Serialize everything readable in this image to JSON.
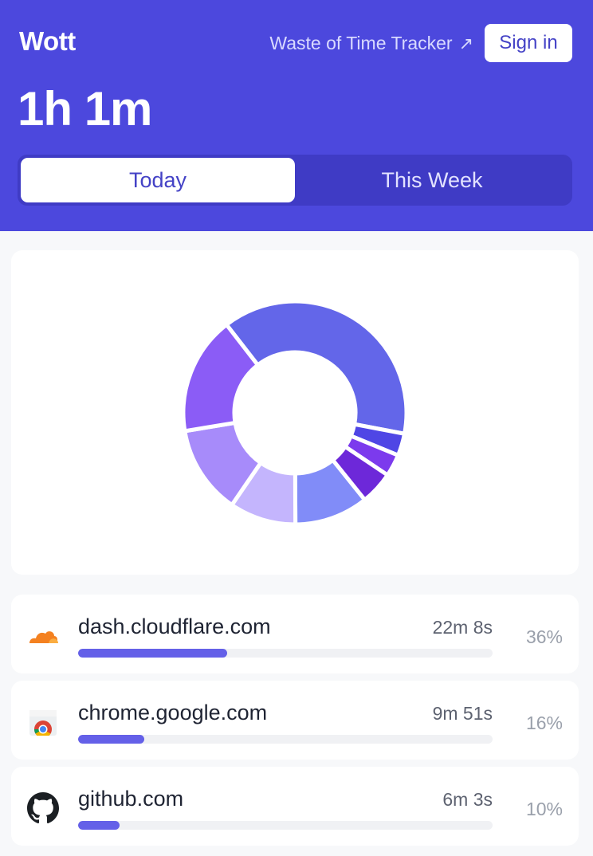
{
  "header": {
    "brand": "Wott",
    "tracker_link": "Waste of Time Tracker",
    "tracker_link_icon": "external-arrow-icon",
    "signin_label": "Sign in",
    "total_time": "1h 1m"
  },
  "tabs": [
    {
      "label": "Today",
      "active": true
    },
    {
      "label": "This Week",
      "active": false
    }
  ],
  "chart_data": {
    "type": "pie",
    "title": "",
    "slices": [
      {
        "value": 36,
        "color": "#6366e9"
      },
      {
        "value": 3.0,
        "color": "#4f46e5"
      },
      {
        "value": 3.0,
        "color": "#7c3aed"
      },
      {
        "value": 4.5,
        "color": "#6d28d9"
      },
      {
        "value": 10,
        "color": "#818cf8"
      },
      {
        "value": 9,
        "color": "#c4b5fd"
      },
      {
        "value": 12,
        "color": "#a78bfa"
      },
      {
        "value": 16,
        "color": "#8b5cf6"
      }
    ]
  },
  "sites": [
    {
      "domain": "dash.cloudflare.com",
      "time": "22m 8s",
      "percent": "36%",
      "fraction": 0.36,
      "icon": "cloudflare-icon"
    },
    {
      "domain": "chrome.google.com",
      "time": "9m 51s",
      "percent": "16%",
      "fraction": 0.16,
      "icon": "chrome-web-store-icon"
    },
    {
      "domain": "github.com",
      "time": "6m 3s",
      "percent": "10%",
      "fraction": 0.1,
      "icon": "github-icon"
    }
  ],
  "colors": {
    "header_bg": "#4c48dd",
    "accent": "#4442c6",
    "bar_fill": "#6460e8"
  }
}
